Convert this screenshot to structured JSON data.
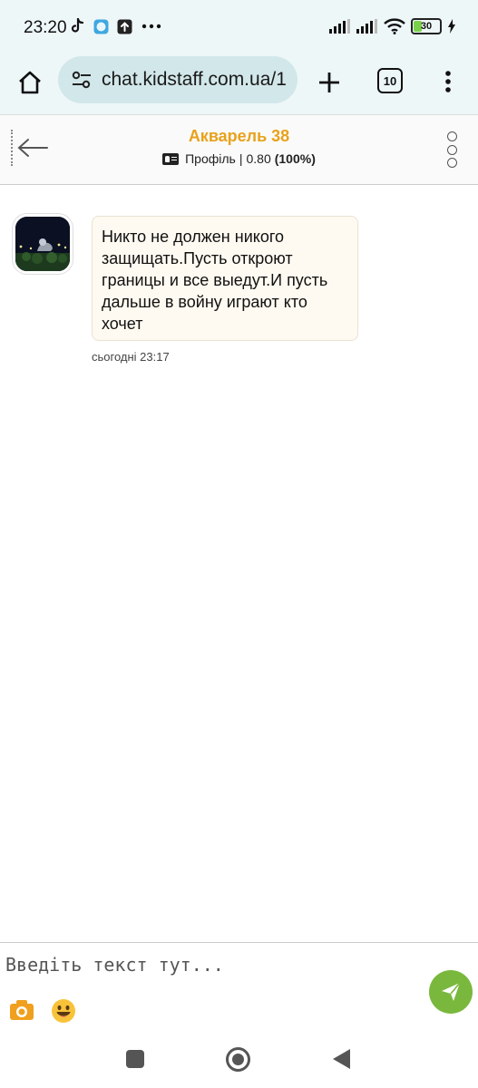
{
  "status_bar": {
    "time": "23:20",
    "battery_level": "30",
    "icons": [
      "tiktok-icon",
      "app-icon",
      "upload-icon",
      "more-dots-icon",
      "signal-icon",
      "signal-icon",
      "wifi-icon",
      "battery-icon",
      "charging-icon"
    ]
  },
  "browser": {
    "url": "chat.kidstaff.com.ua/1",
    "tab_count": "10",
    "accent": "#d2e7ea"
  },
  "chat": {
    "title": "Акварель 38",
    "profile_label": "Профіль",
    "separator": "|",
    "rating": "0.80",
    "rating_percent": "(100%)",
    "title_color": "#e8a21c"
  },
  "messages": [
    {
      "text": "Никто не должен никого защищать.Пусть откроют границы и все выедут.И пусть дальше в войну играют кто хочет",
      "time": "сьогодні 23:17"
    }
  ],
  "composer": {
    "placeholder": "Введіть текст тут...",
    "send_color": "#79b83d"
  }
}
